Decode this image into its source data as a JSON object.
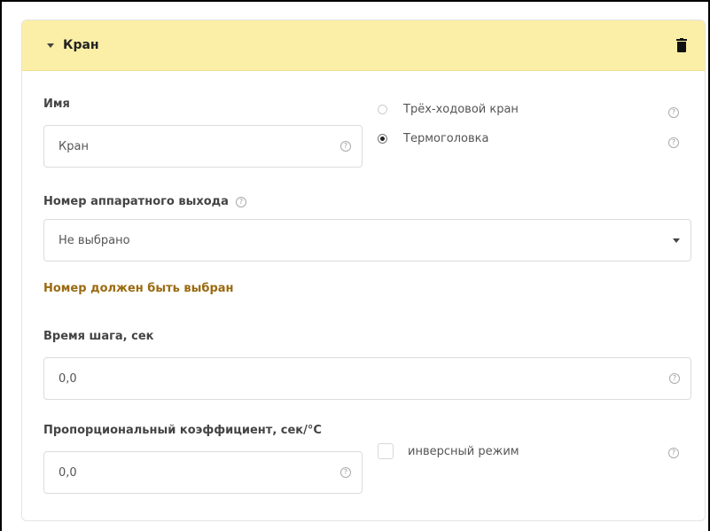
{
  "panel": {
    "title": "Кран"
  },
  "name_field": {
    "label": "Имя",
    "value": "Кран"
  },
  "valve_type": {
    "options": [
      {
        "label": "Трёх-ходовой кран",
        "selected": false
      },
      {
        "label": "Термоголовка",
        "selected": true
      }
    ]
  },
  "hardware_output": {
    "label": "Номер аппаратного выхода",
    "value": "Не выбрано",
    "error": "Номер должен быть выбран"
  },
  "step_time": {
    "label": "Время шага, сек",
    "value": "0,0"
  },
  "proportional_coef": {
    "label": "Пропорциональный коэффициент, сек/°С",
    "value": "0,0"
  },
  "inverse_mode": {
    "label": "инверсный режим",
    "checked": false
  },
  "icons": {
    "help": "?",
    "delete": "trash-icon",
    "collapse": "caret-down-icon"
  },
  "colors": {
    "header_bg": "#fbeea6",
    "error_text": "#9a6a10"
  }
}
